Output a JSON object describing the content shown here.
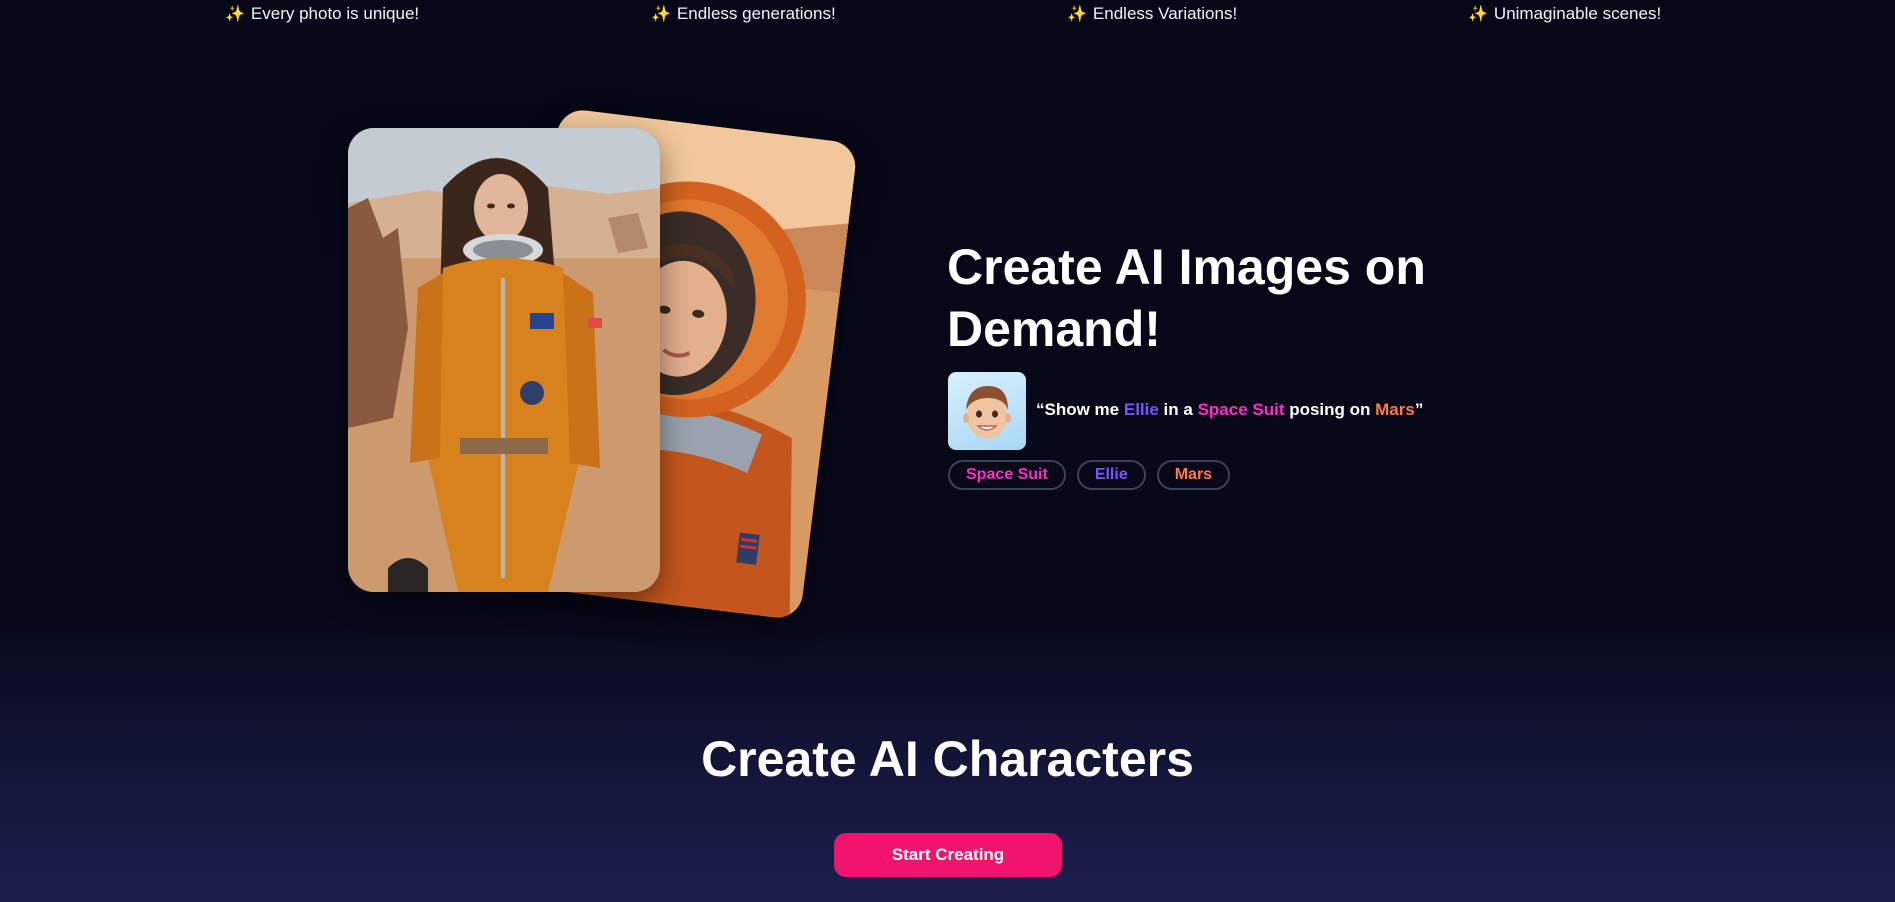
{
  "features": [
    {
      "icon": "sparkle-icon",
      "text": "Every photo is unique!"
    },
    {
      "icon": "sparkle-icon",
      "text": "Endless generations!"
    },
    {
      "icon": "sparkle-icon",
      "text": "Endless Variations!"
    },
    {
      "icon": "sparkle-icon",
      "text": "Unimaginable scenes!"
    }
  ],
  "hero": {
    "title": "Create AI Images on Demand!",
    "avatar_icon": "memoji-avatar",
    "prompt": {
      "open_quote": "“Show me ",
      "name": "Ellie",
      "mid1": " in a ",
      "outfit": "Space Suit",
      "mid2": " posing on ",
      "place": "Mars",
      "close_quote": "”"
    },
    "tags": [
      {
        "label": "Space Suit",
        "color": "#ff2ec4"
      },
      {
        "label": "Ellie",
        "color": "#7b52ff"
      },
      {
        "label": "Mars",
        "color": "#ff7a45"
      }
    ]
  },
  "section": {
    "title": "Create AI Characters",
    "cta_label": "Start Creating"
  },
  "colors": {
    "background": "#070918",
    "accent": "#f0146c",
    "purple": "#7b52ff",
    "pink": "#ff2ec4",
    "orange": "#ff7a45"
  }
}
